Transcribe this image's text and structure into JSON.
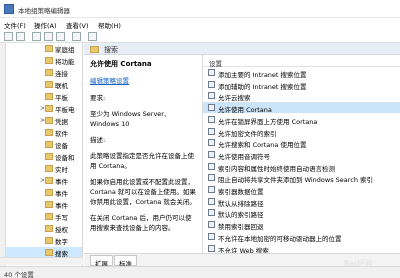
{
  "window": {
    "title": "本地组策略编辑器"
  },
  "menu": [
    "文件(F)",
    "操作(A)",
    "查看(V)",
    "帮助(H)"
  ],
  "tree": {
    "items": [
      {
        "expander": "",
        "label": "家庭组"
      },
      {
        "expander": "",
        "label": "将功能"
      },
      {
        "expander": "",
        "label": "连接"
      },
      {
        "expander": "",
        "label": "联机"
      },
      {
        "expander": "",
        "label": "平板"
      },
      {
        "expander": ">",
        "label": "平板电"
      },
      {
        "expander": ">",
        "label": "凭据"
      },
      {
        "expander": "",
        "label": "软件"
      },
      {
        "expander": "",
        "label": "设备"
      },
      {
        "expander": "",
        "label": "设备和"
      },
      {
        "expander": "",
        "label": "实时"
      },
      {
        "expander": ">",
        "label": "事件"
      },
      {
        "expander": "",
        "label": "事件"
      },
      {
        "expander": "",
        "label": "事件"
      },
      {
        "expander": "",
        "label": "手写"
      },
      {
        "expander": "",
        "label": "授权"
      },
      {
        "expander": "",
        "label": "数字"
      },
      {
        "expander": "",
        "label": "搜索"
      }
    ],
    "selected_index": 17
  },
  "header": {
    "title": "搜索"
  },
  "desc": {
    "title": "允许使用 Cortana",
    "edit_link": "编辑策略设置",
    "req_label": "要求:",
    "req_value": "至少为 Windows Server、Windows 10",
    "desc_label": "描述:",
    "p1": "此策略设置指定是否允许在设备上使用 Cortana。",
    "p2": "如果你启用此设置或不配置此设置，Cortana 就可以在设备上使用。如果你禁用此设置，Cortana 就会关闭。",
    "p3": "在关闭 Cortana 后，用户仍可以使用搜索来查找设备上的内容。"
  },
  "list": {
    "header": "设置",
    "rows": [
      "添加主要的 Intranet 搜索位置",
      "添加辅助的 Intranet 搜索位置",
      "允许云搜索",
      "允许使用 Cortana",
      "允许在锁屏界面上方使用 Cortana",
      "允许加密文件的索引",
      "允许搜索和 Cortana 使用位置",
      "允许使用音调符号",
      "索引内容和属性时始终使用自动语言检测",
      "阻止自动将共享文件夹添加到 Windows Search 索引",
      "索引器数据位置",
      "默认从排除路径",
      "默认的索引路径",
      "禁用索引器回退",
      "不允许在本地加密的可移动驱动器上的位置",
      "不允许 Web 搜索"
    ],
    "selected_index": 3
  },
  "tabs": [
    "扩展",
    "标准"
  ],
  "status": {
    "text": "40 个设置"
  },
  "watermark": "Bai经验"
}
